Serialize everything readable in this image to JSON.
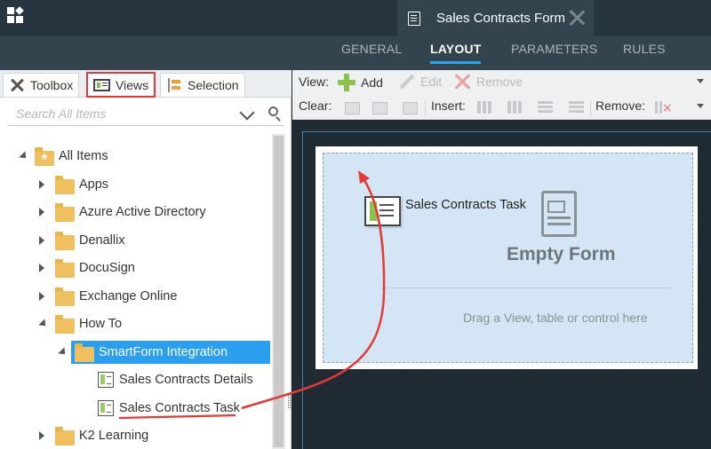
{
  "header": {
    "doc_tab_title": "Sales Contracts Form"
  },
  "nav_tabs": [
    {
      "label": "GENERAL",
      "active": false
    },
    {
      "label": "LAYOUT",
      "active": true
    },
    {
      "label": "PARAMETERS",
      "active": false
    },
    {
      "label": "RULES",
      "active": false
    }
  ],
  "left_panel": {
    "tabs": [
      {
        "label": "Toolbox",
        "selected": false
      },
      {
        "label": "Views",
        "selected": true
      },
      {
        "label": "Selection",
        "selected": false
      }
    ],
    "search": {
      "placeholder": "Search All Items"
    },
    "tree": [
      {
        "label": "All Items",
        "expanded": true
      },
      {
        "label": "Apps",
        "expanded": false
      },
      {
        "label": "Azure Active Directory",
        "expanded": false
      },
      {
        "label": "Denallix",
        "expanded": false
      },
      {
        "label": "DocuSign",
        "expanded": false
      },
      {
        "label": "Exchange Online",
        "expanded": false
      },
      {
        "label": "How To",
        "expanded": true
      },
      {
        "label": "SmartForm Integration",
        "expanded": true,
        "highlighted": true
      },
      {
        "label": "Sales Contracts Details",
        "type": "view"
      },
      {
        "label": "Sales Contracts Task",
        "type": "view",
        "underlined": true
      },
      {
        "label": "K2 Learning",
        "expanded": false
      }
    ]
  },
  "toolbar": {
    "view_label": "View:",
    "add_label": "Add",
    "edit_label": "Edit",
    "remove_label": "Remove",
    "clear_label": "Clear:",
    "insert_label": "Insert:",
    "remove2_label": "Remove:"
  },
  "canvas": {
    "dragged_view": "Sales Contracts Task",
    "empty_title": "Empty Form",
    "hint": "Drag a View, table or control here"
  },
  "colors": {
    "accent": "#2a9ff0",
    "annotation": "#e53935",
    "drop_zone": "#d4e6f5"
  }
}
